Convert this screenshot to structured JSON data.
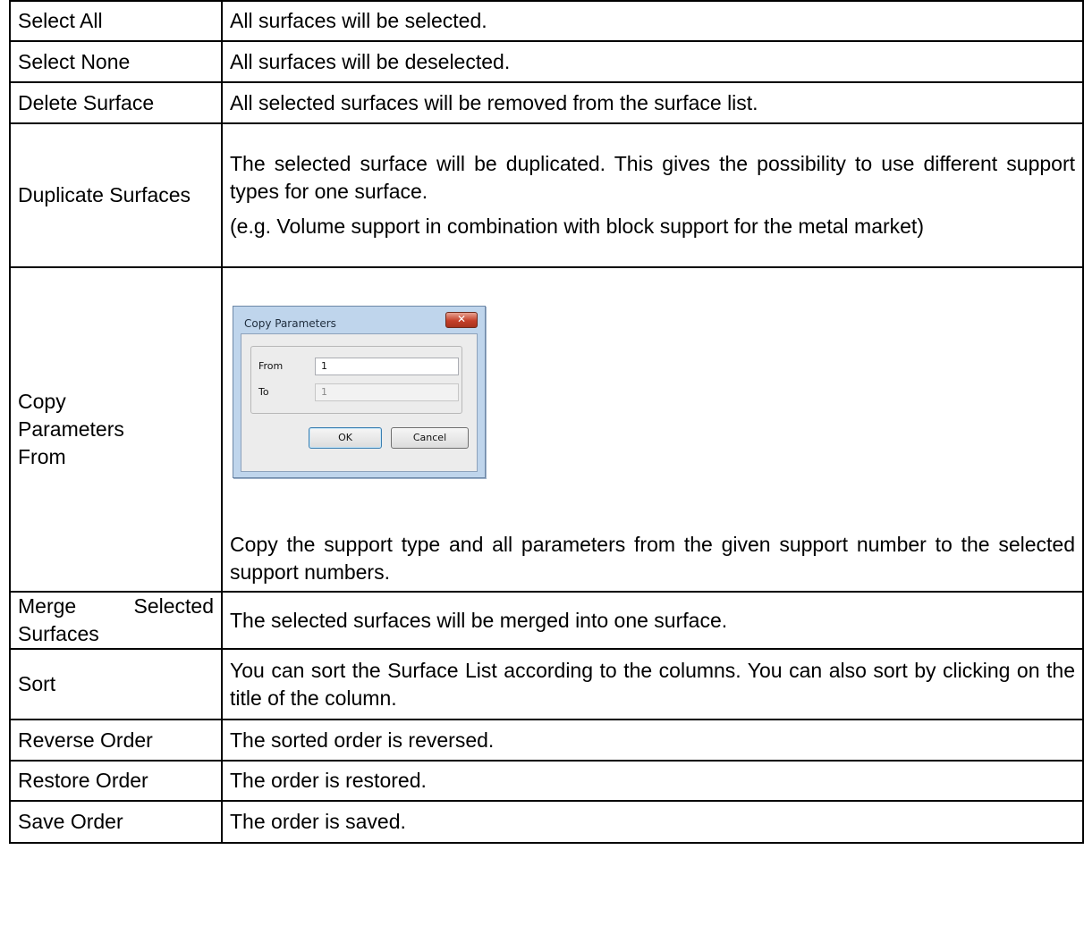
{
  "rows": [
    {
      "command": "Select All",
      "description": [
        "All surfaces will be selected."
      ]
    },
    {
      "command": "Select None",
      "description": [
        "All surfaces will be deselected."
      ]
    },
    {
      "command": "Delete Surface",
      "description": [
        "All selected surfaces will be removed from the surface list."
      ]
    },
    {
      "command": "Duplicate Surfaces",
      "description": [
        "The selected surface will be duplicated. This gives the possibility to use different support types for one surface.",
        "(e.g. Volume support in combination with block support for the metal market)"
      ]
    },
    {
      "command": "Copy Parameters From",
      "description": [
        "Copy the support type and all parameters from the given support number to the selected support numbers."
      ]
    },
    {
      "command": "Merge Selected Surfaces",
      "description": [
        "The selected surfaces will be merged into one surface."
      ]
    },
    {
      "command": "Sort",
      "description": [
        "You can sort the Surface List according to the columns. You can also sort by clicking on the title of the column."
      ]
    },
    {
      "command": "Reverse Order",
      "description": [
        "The sorted order is reversed."
      ]
    },
    {
      "command": "Restore Order",
      "description": [
        "The order is restored."
      ]
    },
    {
      "command": "Save Order",
      "description": [
        "The order is saved."
      ]
    }
  ],
  "merge_label_parts": [
    "Merge",
    "Selected",
    "Surfaces"
  ],
  "dialog": {
    "title": "Copy Parameters",
    "close_glyph": "✕",
    "from_label": "From",
    "from_value": "1",
    "to_label": "To",
    "to_value": "1",
    "ok_label": "OK",
    "cancel_label": "Cancel"
  }
}
